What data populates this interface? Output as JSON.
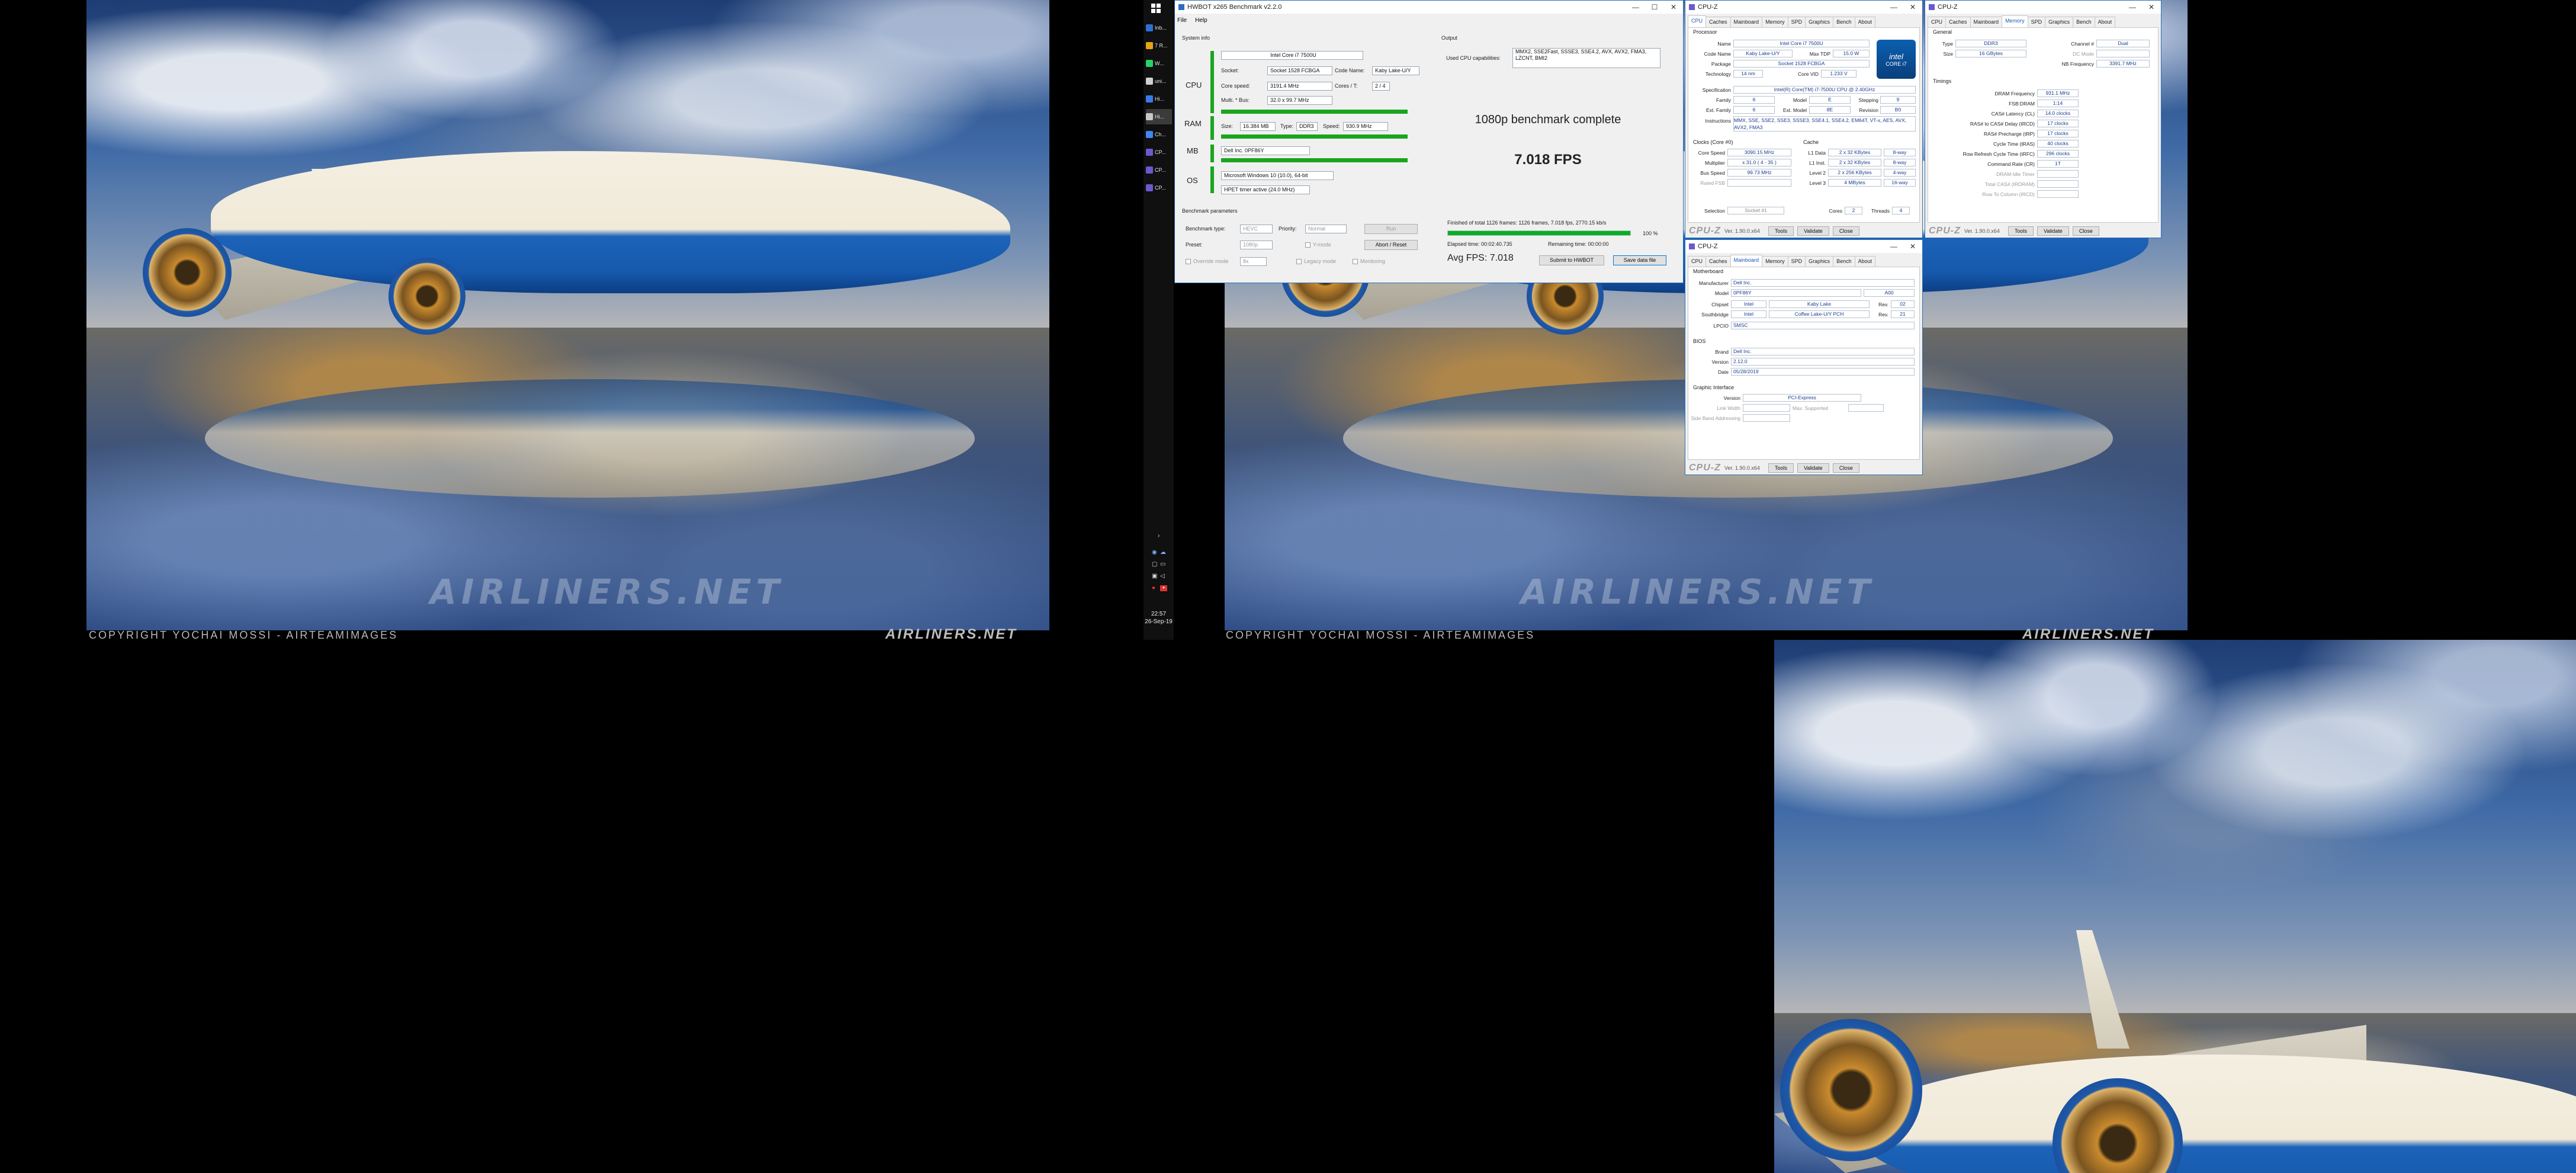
{
  "wallpaper": {
    "caption": "COPYRIGHT YOCHAI MOSSI - AIRTEAMIMAGES",
    "logo": "AIRLINERS.NET",
    "watermark": "AIRLINERS.NET"
  },
  "taskbar": {
    "items": [
      {
        "label": "Inb...",
        "color": "#2f6fd6"
      },
      {
        "label": "7 R...",
        "color": "#e8a317"
      },
      {
        "label": "W...",
        "color": "#25d366"
      },
      {
        "label": "uni...",
        "color": "#d0d0d0"
      },
      {
        "label": "Hi...",
        "color": "#3b7be8"
      },
      {
        "label": "Hi...",
        "color": "#c8c8c8"
      },
      {
        "label": "Ch...",
        "color": "#4285f4"
      },
      {
        "label": "CP...",
        "color": "#6a5acd"
      },
      {
        "label": "CP...",
        "color": "#6a5acd"
      },
      {
        "label": "CP...",
        "color": "#6a5acd"
      }
    ],
    "clock_time": "22:57",
    "clock_date": "26-Sep-19"
  },
  "hwbot": {
    "title": "HWBOT x265 Benchmark v2.2.0",
    "menu": [
      "File",
      "Help"
    ],
    "system_info": {
      "heading": "System info",
      "cpu_label": "CPU",
      "ram_label": "RAM",
      "mb_label": "MB",
      "os_label": "OS",
      "cpu_name": "Intel Core i7 7500U",
      "socket_label": "Socket:",
      "socket": "Socket 1528 FCBGA",
      "codename_label": "Code Name:",
      "codename": "Kaby Lake-U/Y",
      "core_speed_label": "Core speed:",
      "core_speed": "3191.4 MHz",
      "cores_label": "Cores / T:",
      "cores": "2 / 4",
      "mult_label": "Multi. * Bus:",
      "mult": "32.0 x 99.7 MHz",
      "size_label": "Size:",
      "size": "16.384 MB",
      "type_label": "Type:",
      "type": "DDR3",
      "speed_label": "Speed:",
      "speed": "930.9 MHz",
      "mb": "Dell Inc. 0PF86Y",
      "os": "Microsoft Windows 10 (10.0), 64-bit",
      "timer": "HPET timer active (24.0 MHz)"
    },
    "output": {
      "heading": "Output",
      "caps_label": "Used CPU capabilities:",
      "caps": "MMX2, SSE2Fast, SSSE3, SSE4.2, AVX, AVX2, FMA3, LZCNT, BMI2",
      "status": "1080p benchmark complete",
      "fps": "7.018 FPS",
      "finished": "Finished of total 1126 frames: 1126 frames, 7.018 fps, 2770.15 kb/s",
      "progress": 100,
      "progress_label": "100 %",
      "elapsed": "Elapsed time: 00:02:40.735",
      "remaining": "Remaining time: 00:00:00",
      "avg_fps": "Avg FPS: 7.018"
    },
    "params": {
      "heading": "Benchmark parameters",
      "type_label": "Benchmark type:",
      "type_value": "HEVC",
      "priority_label": "Priority:",
      "priority_value": "Normal",
      "run": "Run",
      "preset_label": "Preset:",
      "preset_value": "1080p",
      "abort": "Abort / Reset",
      "override": "Override mode",
      "override_value": "8x",
      "ymode": "Y-mode",
      "legacy": "Legacy mode",
      "monitoring": "Monitoring",
      "submit": "Submit to HWBOT",
      "save": "Save data file"
    }
  },
  "cpuz_cpu": {
    "title": "CPU-Z",
    "tabs": [
      "CPU",
      "Caches",
      "Mainboard",
      "Memory",
      "SPD",
      "Graphics",
      "Bench",
      "About"
    ],
    "processor_title": "Processor",
    "name_label": "Name",
    "name": "Intel Core i7 7500U",
    "codename_label": "Code Name",
    "codename": "Kaby Lake-U/Y",
    "maxtdp_label": "Max TDP",
    "maxtdp": "15.0 W",
    "package_label": "Package",
    "package": "Socket 1528 FCBGA",
    "tech_label": "Technology",
    "tech": "14 nm",
    "corevid_label": "Core VID",
    "corevid": "1.233 V",
    "spec_label": "Specification",
    "spec": "Intel(R) Core(TM) i7-7500U CPU @ 2.40GHz",
    "family_label": "Family",
    "family": "6",
    "model_label": "Model",
    "model": "E",
    "stepping_label": "Stepping",
    "stepping": "9",
    "extfamily_label": "Ext. Family",
    "extfamily": "6",
    "extmodel_label": "Ext. Model",
    "extmodel": "8E",
    "revision_label": "Revision",
    "revision": "B0",
    "instr_label": "Instructions",
    "instr": "MMX, SSE, SSE2, SSE3, SSSE3, SSE4.1, SSE4.2, EM64T, VT-x, AES, AVX, AVX2, FMA3",
    "clocks_title": "Clocks (Core #0)",
    "corespeed_label": "Core Speed",
    "corespeed": "3090.15 MHz",
    "multiplier_label": "Multiplier",
    "multiplier": "x 31.0 ( 4 - 35 )",
    "busspeed_label": "Bus Speed",
    "busspeed": "99.73 MHz",
    "ratedfsb_label": "Rated FSB",
    "cache_title": "Cache",
    "l1d_label": "L1 Data",
    "l1d": "2 x 32 KBytes",
    "l1d_way": "8-way",
    "l1i_label": "L1 Inst.",
    "l1i": "2 x 32 KBytes",
    "l1i_way": "8-way",
    "l2_label": "Level 2",
    "l2": "2 x 256 KBytes",
    "l2_way": "4-way",
    "l3_label": "Level 3",
    "l3": "4 MBytes",
    "l3_way": "16-way",
    "selection_label": "Selection",
    "selection": "Socket #1",
    "cores_label": "Cores",
    "cores": "2",
    "threads_label": "Threads",
    "threads": "4",
    "logo_top": "intel",
    "logo_mid": "CORE i7",
    "footer_logo": "CPU-Z",
    "version": "Ver. 1.90.0.x64",
    "tools": "Tools",
    "validate": "Validate",
    "close": "Close"
  },
  "cpuz_mem": {
    "title": "CPU-Z",
    "tabs": [
      "CPU",
      "Caches",
      "Mainboard",
      "Memory",
      "SPD",
      "Graphics",
      "Bench",
      "About"
    ],
    "general_title": "General",
    "type_label": "Type",
    "type": "DDR3",
    "channel_label": "Channel #",
    "channel": "Dual",
    "size_label": "Size",
    "size": "16 GBytes",
    "dcmode_label": "DC Mode",
    "nb_label": "NB Frequency",
    "nb": "3391.7 MHz",
    "timings_title": "Timings",
    "dram_label": "DRAM Frequency",
    "dram": "931.1 MHz",
    "fsb_label": "FSB:DRAM",
    "fsb": "1:14",
    "cl_label": "CAS# Latency (CL)",
    "cl": "14.0 clocks",
    "rcd_label": "RAS# to CAS# Delay (tRCD)",
    "rcd": "17 clocks",
    "rp_label": "RAS# Precharge (tRP)",
    "rp": "17 clocks",
    "ras_label": "Cycle Time (tRAS)",
    "ras": "40 clocks",
    "rfc_label": "Row Refresh Cycle Time (tRFC)",
    "rfc": "296 clocks",
    "cr_label": "Command Rate (CR)",
    "cr": "1T",
    "idle_label": "DRAM Idle Timer",
    "total_cas_label": "Total CAS# (tRDRAM)",
    "row_col_label": "Row To Column (tRCD)",
    "footer_logo": "CPU-Z",
    "version": "Ver. 1.90.0.x64",
    "tools": "Tools",
    "validate": "Validate",
    "close": "Close"
  },
  "cpuz_mb": {
    "title": "CPU-Z",
    "tabs": [
      "CPU",
      "Caches",
      "Mainboard",
      "Memory",
      "SPD",
      "Graphics",
      "Bench",
      "About"
    ],
    "mb_title": "Motherboard",
    "manufacturer_label": "Manufacturer",
    "manufacturer": "Dell Inc.",
    "model_label": "Model",
    "model": "0PF86Y",
    "model_rev": "A00",
    "chipset_label": "Chipset",
    "chipset_vendor": "Intel",
    "chipset": "Kaby Lake",
    "chipset_rev_label": "Rev.",
    "chipset_rev": "02",
    "south_label": "Southbridge",
    "south_vendor": "Intel",
    "south": "Coffee Lake-U/Y PCH",
    "south_rev_label": "Rev.",
    "south_rev": "21",
    "lpcio_label": "LPCIO",
    "lpcio": "SMSC",
    "bios_title": "BIOS",
    "brand_label": "Brand",
    "brand": "Dell Inc.",
    "version_label": "Version",
    "bios_version": "2.12.0",
    "date_label": "Date",
    "date": "05/28/2019",
    "gi_title": "Graphic Interface",
    "gi_version_label": "Version",
    "gi_version": "PCI-Express",
    "link_label": "Link Width",
    "max_label": "Max. Supported",
    "sideband_label": "Side Band Addressing",
    "footer_logo": "CPU-Z",
    "version": "Ver. 1.90.0.x64",
    "tools": "Tools",
    "validate": "Validate",
    "close": "Close"
  }
}
